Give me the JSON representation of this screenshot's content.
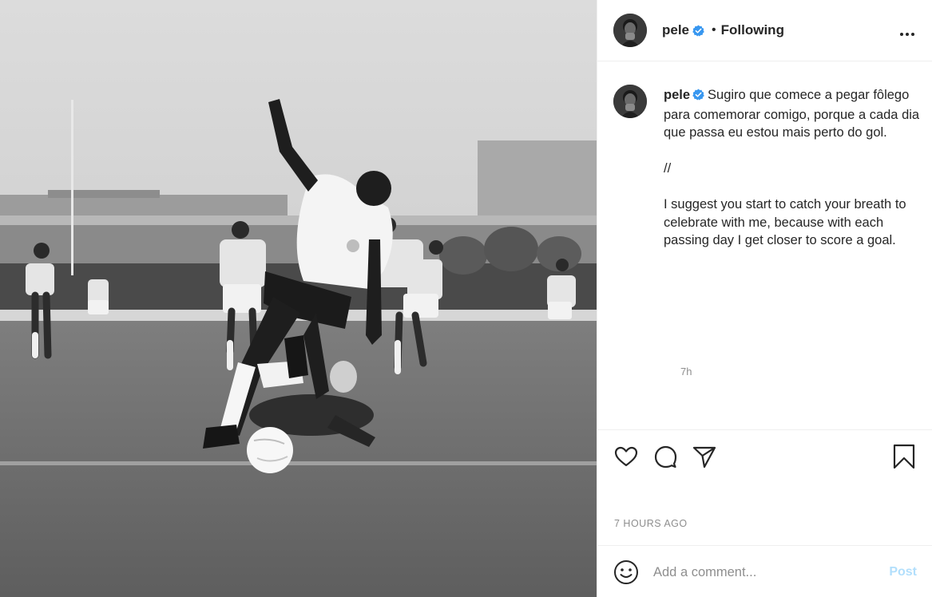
{
  "post": {
    "photo_alt": "Black and white photo of a footballer leaping over a diving goalkeeper",
    "author": {
      "username": "pele",
      "verified": true,
      "follow_state": "Following",
      "separator": "•",
      "avatar_icon": "avatar-photo"
    },
    "caption": {
      "username": "pele",
      "text": "Sugiro que comece a pegar fôlego para comemorar comigo, porque a cada dia que passa eu estou mais perto do gol.\n\n//\n\nI suggest you start to catch your breath to celebrate with me, because with each passing day I get closer to score a goal.",
      "relative_time": "7h"
    },
    "timestamp": "7 HOURS AGO",
    "actions": {
      "like_icon": "heart-icon",
      "comment_icon": "comment-icon",
      "share_icon": "paper-plane-icon",
      "save_icon": "bookmark-icon",
      "more_icon": "more-dots-icon"
    },
    "comment": {
      "placeholder": "Add a comment...",
      "post_label": "Post",
      "emoji_icon": "smiley-icon"
    },
    "colors": {
      "verified_blue": "#3897f0",
      "post_disabled": "#b2dffc",
      "muted_text": "#8e8e8e"
    }
  }
}
